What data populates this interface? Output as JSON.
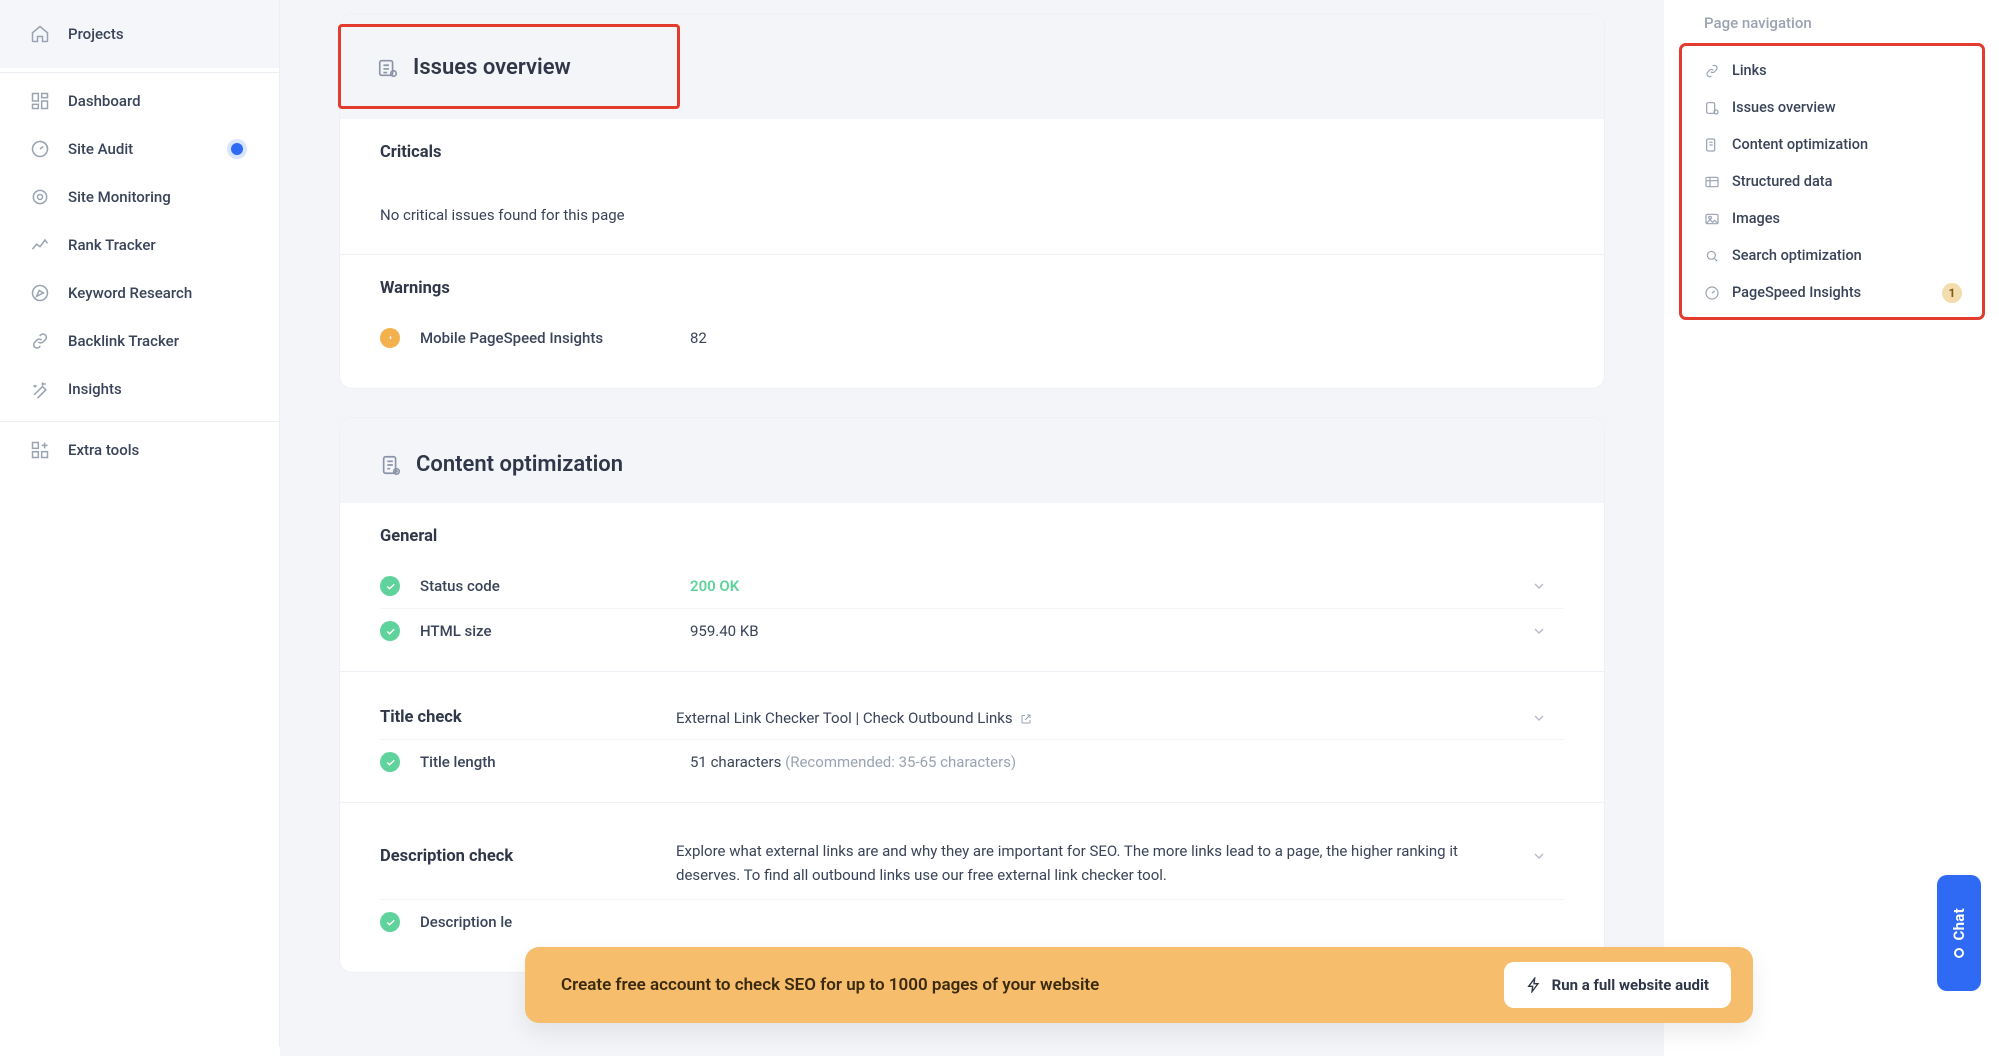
{
  "sidebar": {
    "projects": "Projects",
    "items": [
      {
        "label": "Dashboard",
        "icon": "dashboard-icon"
      },
      {
        "label": "Site Audit",
        "icon": "gauge-icon",
        "active": true
      },
      {
        "label": "Site Monitoring",
        "icon": "target-icon"
      },
      {
        "label": "Rank Tracker",
        "icon": "chart-line-icon"
      },
      {
        "label": "Keyword Research",
        "icon": "compass-icon"
      },
      {
        "label": "Backlink Tracker",
        "icon": "link-icon"
      },
      {
        "label": "Insights",
        "icon": "wand-icon"
      }
    ],
    "extra": "Extra tools"
  },
  "issues": {
    "title": "Issues overview",
    "criticals_label": "Criticals",
    "criticals_msg": "No critical issues found for this page",
    "warnings_label": "Warnings",
    "warning_items": [
      {
        "label": "Mobile PageSpeed Insights",
        "value": "82"
      }
    ]
  },
  "content": {
    "title": "Content optimization",
    "general_label": "General",
    "status_code_label": "Status code",
    "status_code_value": "200 OK",
    "html_size_label": "HTML size",
    "html_size_value": "959.40 KB",
    "title_check_label": "Title check",
    "title_check_value": "External Link Checker Tool | Check Outbound Links",
    "title_len_label": "Title length",
    "title_len_value": "51 characters",
    "title_len_reco": "(Recommended: 35-65 characters)",
    "desc_check_label": "Description check",
    "desc_check_value": "Explore what external links are and why they are important for SEO. The more links lead to a page, the higher ranking it deserves. To find all outbound links use our free external link checker tool.",
    "desc_len_label": "Description le"
  },
  "pagenav": {
    "title": "Page navigation",
    "items": [
      {
        "label": "Links",
        "icon": "link-icon"
      },
      {
        "label": "Issues overview",
        "icon": "issues-icon"
      },
      {
        "label": "Content optimization",
        "icon": "content-icon"
      },
      {
        "label": "Structured data",
        "icon": "structured-icon"
      },
      {
        "label": "Images",
        "icon": "image-icon"
      },
      {
        "label": "Search optimization",
        "icon": "search-icon"
      },
      {
        "label": "PageSpeed Insights",
        "icon": "speed-icon",
        "badge": "1"
      }
    ]
  },
  "banner": {
    "text": "Create free account to check SEO for up to 1000 pages of your website",
    "button": "Run a full website audit"
  },
  "chat": {
    "label": "Chat"
  }
}
